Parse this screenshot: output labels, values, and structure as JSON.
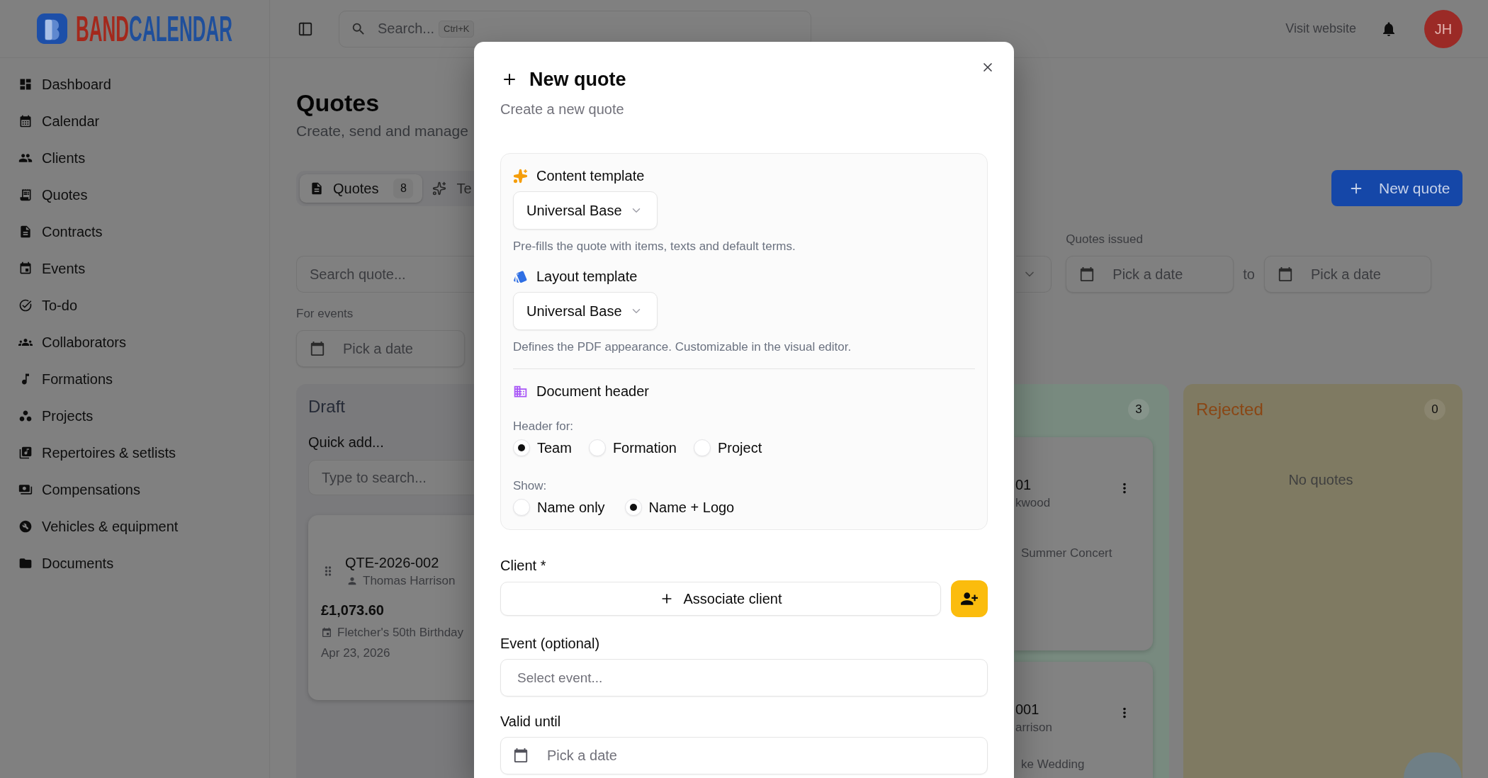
{
  "sidebar": {
    "logo": {
      "wordmark": [
        "BAND",
        "CALENDAR"
      ]
    },
    "items": [
      {
        "label": "Dashboard"
      },
      {
        "label": "Calendar"
      },
      {
        "label": "Clients"
      },
      {
        "label": "Quotes"
      },
      {
        "label": "Contracts"
      },
      {
        "label": "Events"
      },
      {
        "label": "To-do"
      },
      {
        "label": "Collaborators"
      },
      {
        "label": "Formations"
      },
      {
        "label": "Projects"
      },
      {
        "label": "Repertoires & setlists"
      },
      {
        "label": "Compensations"
      },
      {
        "label": "Vehicles & equipment"
      },
      {
        "label": "Documents"
      }
    ]
  },
  "topbar": {
    "search": {
      "placeholder": "Search...",
      "shortcut": "Ctrl+K"
    },
    "link": "Visit website",
    "avatar": "JH"
  },
  "page": {
    "title": "Quotes",
    "subtitle": "Create, send and manage",
    "tabs": [
      {
        "label": "Quotes",
        "count": "8",
        "selected": true
      },
      {
        "label": "Te",
        "selected": false
      }
    ],
    "new_button": "New quote",
    "search": {
      "placeholder": "Search quote..."
    },
    "events_filter": {
      "label": "For events",
      "placeholder": "Pick a date"
    },
    "issued_filter": {
      "label": "Quotes issued",
      "from_placeholder": "Pick a date",
      "separator": "to",
      "to_placeholder": "Pick a date"
    }
  },
  "board": {
    "columns": [
      {
        "kind": "draft",
        "title": "Draft",
        "color": "#7a7a7c",
        "quick_add": {
          "label": "Quick add...",
          "placeholder": "Type to search..."
        },
        "cards": [
          {
            "number": "QTE-2026-002",
            "client": "Thomas Harrison",
            "amount": "£1,073.60",
            "event": "Fletcher's 50th Birthday",
            "date": "Apr 23, 2026"
          }
        ]
      },
      {
        "kind": "clipped",
        "count": "3",
        "color": "#788a7f",
        "cards": [
          {
            "number": "01",
            "client": "kwood",
            "event": "Summer Concert"
          },
          {
            "number": "001",
            "client": "arrison",
            "event": "ke Wedding"
          }
        ]
      },
      {
        "kind": "empty",
        "title": "Rejected",
        "count": "0",
        "color": "#7f7a62",
        "empty_text": "No quotes"
      }
    ]
  },
  "dialog": {
    "title": "New quote",
    "subtitle": "Create a new quote",
    "template_card": {
      "content_template": {
        "label": "Content template",
        "value": "Universal Base",
        "hint": "Pre-fills the quote with items, texts and default terms."
      },
      "layout_template": {
        "label": "Layout template",
        "value": "Universal Base",
        "hint": "Defines the PDF appearance. Customizable in the visual editor."
      },
      "document_header": {
        "label": "Document header",
        "header_for": {
          "label": "Header for:",
          "options": [
            {
              "label": "Team",
              "selected": true
            },
            {
              "label": "Formation",
              "selected": false
            },
            {
              "label": "Project",
              "selected": false
            }
          ]
        },
        "show": {
          "label": "Show:",
          "options": [
            {
              "label": "Name only",
              "selected": false
            },
            {
              "label": "Name + Logo",
              "selected": true
            }
          ]
        }
      }
    },
    "client": {
      "label": "Client *",
      "button": "Associate client"
    },
    "event": {
      "label": "Event (optional)",
      "placeholder": "Select event..."
    },
    "valid_until": {
      "label": "Valid until",
      "placeholder": "Pick a date"
    }
  }
}
